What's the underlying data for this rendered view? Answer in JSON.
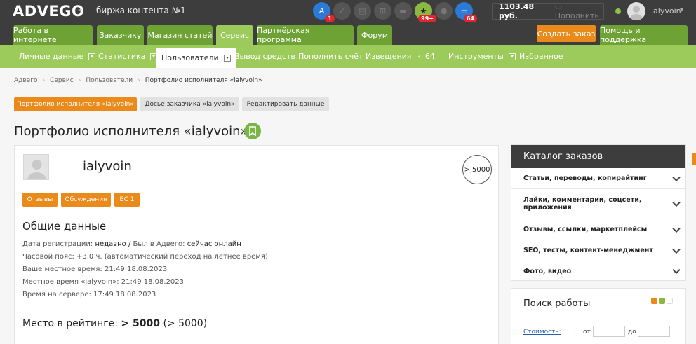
{
  "header": {
    "logo": "ADVEGO",
    "dash": "–",
    "tagline": "биржа контента №1",
    "icons": [
      {
        "name": "translate-icon",
        "glyph": "A",
        "badge": "1",
        "active": true,
        "color": "blue"
      },
      {
        "name": "check-icon",
        "glyph": "✓",
        "badge": "",
        "active": false,
        "color": "gray"
      },
      {
        "name": "document-icon",
        "glyph": "▤",
        "badge": "",
        "active": false,
        "color": "gray"
      },
      {
        "name": "cart-icon",
        "glyph": "⊞",
        "badge": "",
        "active": false,
        "color": "gray"
      },
      {
        "name": "folder-icon",
        "glyph": "▬",
        "badge": "",
        "active": false,
        "color": "gray"
      },
      {
        "name": "star-icon",
        "glyph": "★",
        "badge": "99+",
        "active": true,
        "color": "green"
      },
      {
        "name": "chat-icon",
        "glyph": "●",
        "badge": "",
        "active": false,
        "color": "gray"
      },
      {
        "name": "list-icon",
        "glyph": "☰",
        "badge": "64",
        "active": true,
        "color": "blue"
      }
    ],
    "balance": "1103.48 руб.",
    "topup_label": "Пополнить",
    "username": "ialyvoin",
    "caret": "▾"
  },
  "main_nav": {
    "tabs": [
      {
        "label": "Работа в интернете",
        "active": false
      },
      {
        "label": "Заказчику",
        "active": false
      },
      {
        "label": "Магазин статей",
        "active": false
      },
      {
        "label": "Сервис",
        "active": true
      },
      {
        "label": "Партнёрская программа",
        "active": false
      },
      {
        "label": "Форум",
        "active": false
      }
    ],
    "order_button": "Создать заказ",
    "help_tab": "Помощь и поддержка"
  },
  "sub_nav": {
    "tabs": [
      {
        "label": "Личные данные",
        "dropdown": true,
        "active": false
      },
      {
        "label": "Статистика",
        "dropdown": true,
        "active": false
      },
      {
        "label": "Пользователи",
        "dropdown": true,
        "active": true
      },
      {
        "label": "Вывод средств",
        "dropdown": false,
        "active": false
      },
      {
        "label": "Пополнить счёт",
        "dropdown": false,
        "active": false
      },
      {
        "label": "Извещения",
        "dropdown": false,
        "active": false,
        "count_arrow": "‹",
        "count": "64"
      },
      {
        "label": "Инструменты",
        "dropdown": true,
        "active": false
      },
      {
        "label": "Избранное",
        "dropdown": false,
        "active": false
      }
    ]
  },
  "breadcrumb": {
    "items": [
      "Адвего",
      "Сервис",
      "Пользователи"
    ],
    "current": "Портфолио исполнителя «ialyvoin»"
  },
  "page_tabs": [
    {
      "label": "Портфолио исполнителя «ialyvoin»",
      "active": true
    },
    {
      "label": "Досье заказчика «ialyvoin»",
      "active": false
    },
    {
      "label": "Редактировать данные",
      "active": false
    }
  ],
  "page_title": "Портфолио исполнителя «ialyvoin»",
  "profile": {
    "name": "ialyvoin",
    "rating_badge": "> 5000",
    "buttons": [
      "Отзывы",
      "Обсуждения",
      "БС 1"
    ],
    "section_title": "Общие данные",
    "reg_label": "Дата регистрации:",
    "reg_value": "недавно",
    "slash": "/",
    "seen_label": "Был в Адвего:",
    "seen_value": "сейчас онлайн",
    "timezone": "Часовой пояс: +3.0 ч. (автоматический переход на летнее время)",
    "local_time": "Ваше местное время: 21:49 18.08.2023",
    "user_time": "Местное время «ialyvoin»: 21:49 18.08.2023",
    "server_time": "Время на сервере: 17:49 18.08.2023",
    "rating_label": "Место в рейтинге:",
    "rating_value": "> 5000",
    "rating_paren": "(> 5000)"
  },
  "catalog": {
    "title": "Каталог заказов",
    "items": [
      "Статьи, переводы, копирайтинг",
      "Лайки, комментарии, соцсети, приложения",
      "Отзывы, ссылки, маркетплейсы",
      "SEO, тесты, контент-менеджмент",
      "Фото, видео"
    ]
  },
  "search": {
    "title": "Поиск работы",
    "cost_label": "Стоимость:",
    "from_label": "от",
    "to_label": "до",
    "from_value": "",
    "to_value": ""
  },
  "colors": {
    "dark": "#3d3d3d",
    "green_tab": "#6ea235",
    "green_light": "#9ccb5b",
    "orange": "#e98a1a",
    "blue": "#2a7ad6"
  }
}
